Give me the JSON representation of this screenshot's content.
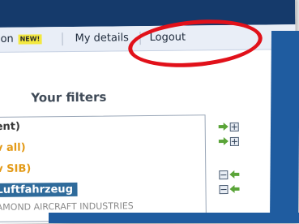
{
  "nav": {
    "partial_item": "on",
    "new_badge": "NEW!",
    "my_details": "My details",
    "logout": "Logout"
  },
  "filters": {
    "title": "Your filters",
    "items": [
      {
        "label": "ent)",
        "style": "dark"
      },
      {
        "label": "v all)",
        "style": "orange"
      },
      {
        "label": "v SIB)",
        "style": "orange"
      },
      {
        "label": "Luftfahrzeug",
        "style": "selected"
      },
      {
        "label": "AMOND AIRCRAFT INDUSTRIES",
        "style": "faded"
      }
    ]
  },
  "colors": {
    "header_bg": "#153a6b",
    "nav_bg": "#e9eef7",
    "selected_bg": "#2f6b9b",
    "orange_text": "#e39a17",
    "highlight_ring": "#e1111a",
    "frame_blue": "#1f5ca0"
  },
  "icons": {
    "add": "arrow-right-plus-icon",
    "remove": "minus-arrow-left-icon"
  }
}
